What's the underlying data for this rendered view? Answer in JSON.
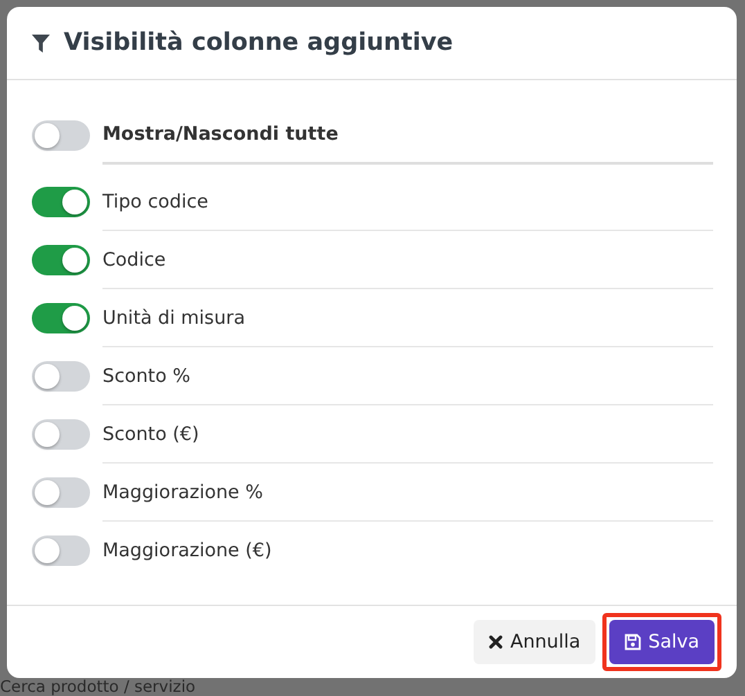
{
  "background": {
    "text": "Cerca prodotto / servizio"
  },
  "dialog": {
    "title": "Visibilità colonne aggiuntive",
    "master": {
      "label": "Mostra/Nascondi tutte",
      "on": false
    },
    "columns": [
      {
        "label": "Tipo codice",
        "on": true
      },
      {
        "label": "Codice",
        "on": true
      },
      {
        "label": "Unità di misura",
        "on": true
      },
      {
        "label": "Sconto %",
        "on": false
      },
      {
        "label": "Sconto (€)",
        "on": false
      },
      {
        "label": "Maggiorazione %",
        "on": false
      },
      {
        "label": "Maggiorazione (€)",
        "on": false
      }
    ],
    "buttons": [
      {
        "kind": "cancel",
        "label": "Annulla",
        "highlighted": false
      },
      {
        "kind": "save",
        "label": "Salva",
        "highlighted": true
      }
    ]
  }
}
